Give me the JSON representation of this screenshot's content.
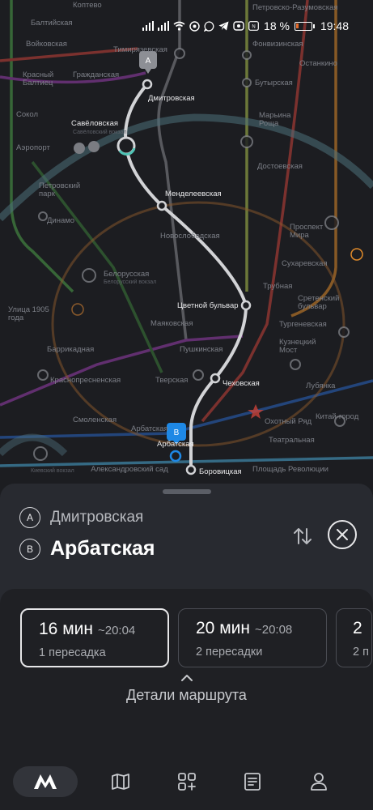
{
  "status": {
    "battery": "18 %",
    "battery_level": 0.18,
    "time": "19:48",
    "icons": [
      "signal-icon",
      "signal-icon",
      "wifi-icon",
      "messenger-icon",
      "whatsapp-icon",
      "telegram-icon",
      "cast-icon",
      "nfc-icon",
      "battery-icon"
    ]
  },
  "map": {
    "markers": {
      "a": "A",
      "b": "B"
    },
    "route_stations": [
      "Дмитровская",
      "Савёловская",
      "Менделеевская",
      "Цветной бульвар",
      "Чеховская",
      "Арбатская",
      "Боровицкая"
    ],
    "labels": [
      "Коптево",
      "Петровско-Разумовская",
      "Балтийская",
      "Фонвизинская",
      "Войковская",
      "Тимирязевская",
      "Останкино",
      "Красный Балтиец",
      "Гражданская",
      "Бутырская",
      "Сокол",
      "Марьина Роща",
      "Аэропорт",
      "Достоевская",
      "Петровский парк",
      "Динамо",
      "Новослободская",
      "Проспект Мира",
      "Белорусская",
      "Сухаревская",
      "Трубная",
      "Сретенский бульвар",
      "Улица 1905 года",
      "Маяковская",
      "Тургеневская",
      "Баррикадная",
      "Пушкинская",
      "Кузнецкий Мост",
      "Краснопресненская",
      "Тверская",
      "Лубянка",
      "Смоленская",
      "Охотный Ряд",
      "Китай-город",
      "Арбатская",
      "Театральная",
      "Александровский сад",
      "Площадь Революции"
    ],
    "small_labels": [
      "Савёловский вокзал",
      "Белорусский вокзал",
      "Киевский вокзал"
    ]
  },
  "route": {
    "from_letter": "A",
    "from": "Дмитровская",
    "to_letter": "B",
    "to": "Арбатская"
  },
  "options": [
    {
      "duration": "16 мин",
      "arrival": "~20:04",
      "transfers": "1 пересадка"
    },
    {
      "duration": "20 мин",
      "arrival": "~20:08",
      "transfers": "2 пересадки"
    },
    {
      "duration": "2",
      "transfers": "2 п"
    }
  ],
  "details_label": "Детали маршрута",
  "nav": {
    "items": [
      "metro-logo-icon",
      "map-icon",
      "services-icon",
      "tickets-icon",
      "profile-icon"
    ]
  },
  "colors": {
    "route": "#d2d3d6",
    "line_green": "#4ea24a",
    "line_orange": "#e08a2a",
    "line_red": "#c9423a",
    "line_blue": "#2a66c5",
    "line_brown": "#8b5a2b",
    "circle_line": "#4d6f7a",
    "marker_b": "#1e88e5",
    "battery_low": "#e56b2c"
  }
}
